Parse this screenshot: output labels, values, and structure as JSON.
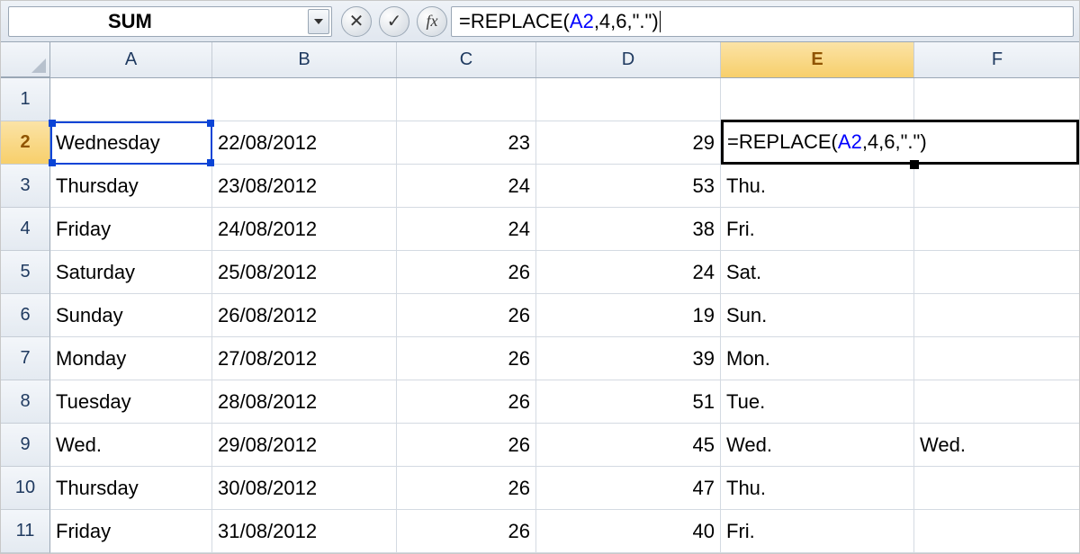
{
  "name_box": {
    "value": "SUM"
  },
  "formula_bar": {
    "prefix": "=REPLACE(",
    "ref": "A2",
    "suffix": ",4,6,\".\")"
  },
  "columns": [
    "A",
    "B",
    "C",
    "D",
    "E",
    "F"
  ],
  "row_headers": [
    "1",
    "2",
    "3",
    "4",
    "5",
    "6",
    "7",
    "8",
    "9",
    "10",
    "11"
  ],
  "active_col": "E",
  "active_row": "2",
  "edit_cell": {
    "prefix": "=REPLACE(",
    "ref": "A2",
    "suffix": ",4,6,\".\")"
  },
  "rows": [
    {
      "A": "",
      "B": "",
      "C": "",
      "D": "",
      "E": "",
      "F": ""
    },
    {
      "A": "Wednesday",
      "B": "22/08/2012",
      "C": "23",
      "D": "29",
      "E": "",
      "F": ""
    },
    {
      "A": "Thursday",
      "B": "23/08/2012",
      "C": "24",
      "D": "53",
      "E": "Thu.",
      "F": ""
    },
    {
      "A": "Friday",
      "B": "24/08/2012",
      "C": "24",
      "D": "38",
      "E": "Fri.",
      "F": ""
    },
    {
      "A": "Saturday",
      "B": "25/08/2012",
      "C": "26",
      "D": "24",
      "E": "Sat.",
      "F": ""
    },
    {
      "A": "Sunday",
      "B": "26/08/2012",
      "C": "26",
      "D": "19",
      "E": "Sun.",
      "F": ""
    },
    {
      "A": "Monday",
      "B": "27/08/2012",
      "C": "26",
      "D": "39",
      "E": "Mon.",
      "F": ""
    },
    {
      "A": "Tuesday",
      "B": "28/08/2012",
      "C": "26",
      "D": "51",
      "E": "Tue.",
      "F": ""
    },
    {
      "A": "Wed.",
      "B": "29/08/2012",
      "C": "26",
      "D": "45",
      "E": "Wed.",
      "F": "Wed."
    },
    {
      "A": "Thursday",
      "B": "30/08/2012",
      "C": "26",
      "D": "47",
      "E": "Thu.",
      "F": ""
    },
    {
      "A": "Friday",
      "B": "31/08/2012",
      "C": "26",
      "D": "40",
      "E": "Fri.",
      "F": ""
    }
  ]
}
